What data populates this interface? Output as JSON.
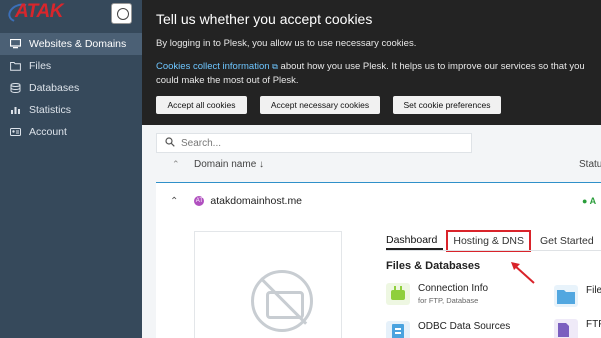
{
  "sidebar": {
    "logo_text": "ATAK",
    "items": [
      {
        "label": "Websites & Domains",
        "icon": "monitor-icon",
        "active": true
      },
      {
        "label": "Files",
        "icon": "folder-icon",
        "active": false
      },
      {
        "label": "Databases",
        "icon": "database-icon",
        "active": false
      },
      {
        "label": "Statistics",
        "icon": "bar-chart-icon",
        "active": false
      },
      {
        "label": "Account",
        "icon": "id-card-icon",
        "active": false
      }
    ]
  },
  "cookie_banner": {
    "title": "Tell us whether you accept cookies",
    "text1": "By logging in to Plesk, you allow us to use necessary cookies.",
    "link": "Cookies collect information",
    "text2": " about how you use Plesk. It helps us to improve our services so that you could make the most out of Plesk.",
    "buttons": {
      "accept_all": "Accept all cookies",
      "accept_necessary": "Accept necessary cookies",
      "preferences": "Set cookie preferences"
    }
  },
  "search": {
    "placeholder": "Search..."
  },
  "table": {
    "col_domain": "Domain name ↓",
    "col_status": "Status",
    "sort_icon": "⌃",
    "row": {
      "domain": "atakdomainhost.me",
      "avatar": "AT",
      "status_text": "● A"
    }
  },
  "tabs": [
    {
      "label": "Dashboard"
    },
    {
      "label": "Hosting & DNS"
    },
    {
      "label": "Get Started"
    }
  ],
  "section": {
    "title": "Files & Databases",
    "tools": [
      {
        "title": "Connection Info",
        "sub": "for FTP, Database",
        "icon": "connection-icon",
        "color": "#8fcf3c"
      },
      {
        "title": "Files",
        "sub": "",
        "icon": "folder-icon",
        "color": "#52a7e0"
      },
      {
        "title": "ODBC Data Sources",
        "sub": "",
        "icon": "odbc-icon",
        "color": "#4aa3df"
      },
      {
        "title": "FTP",
        "sub": "",
        "icon": "ftp-icon",
        "color": "#7b5fbf"
      }
    ]
  },
  "colors": {
    "accent": "#2f90c9",
    "highlight": "#d9232a",
    "sidebar": "#36495b"
  }
}
